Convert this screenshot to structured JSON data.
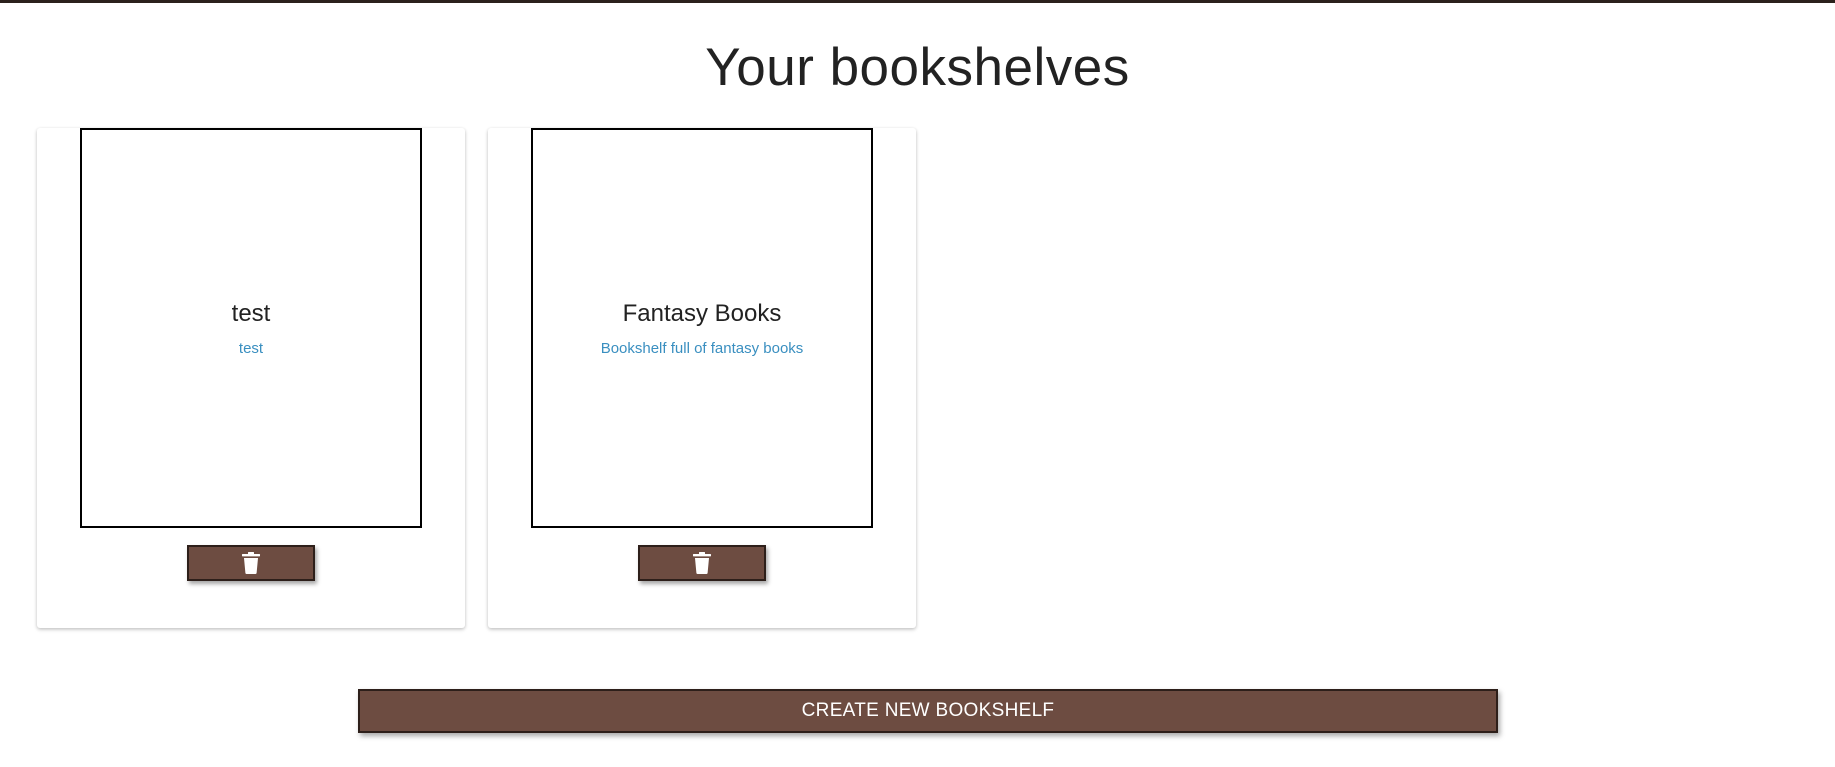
{
  "page": {
    "title": "Your bookshelves"
  },
  "bookshelves": [
    {
      "name": "test",
      "description": "test",
      "delete_icon": "trash-icon"
    },
    {
      "name": "Fantasy Books",
      "description": "Bookshelf full of fantasy books",
      "delete_icon": "trash-icon"
    }
  ],
  "actions": {
    "create_label": "CREATE NEW BOOKSHELF"
  },
  "colors": {
    "button_bg": "#6d4c41",
    "button_border": "#2d1f1a",
    "description_text": "#3a8fc0",
    "top_strip": "#2b211c"
  }
}
